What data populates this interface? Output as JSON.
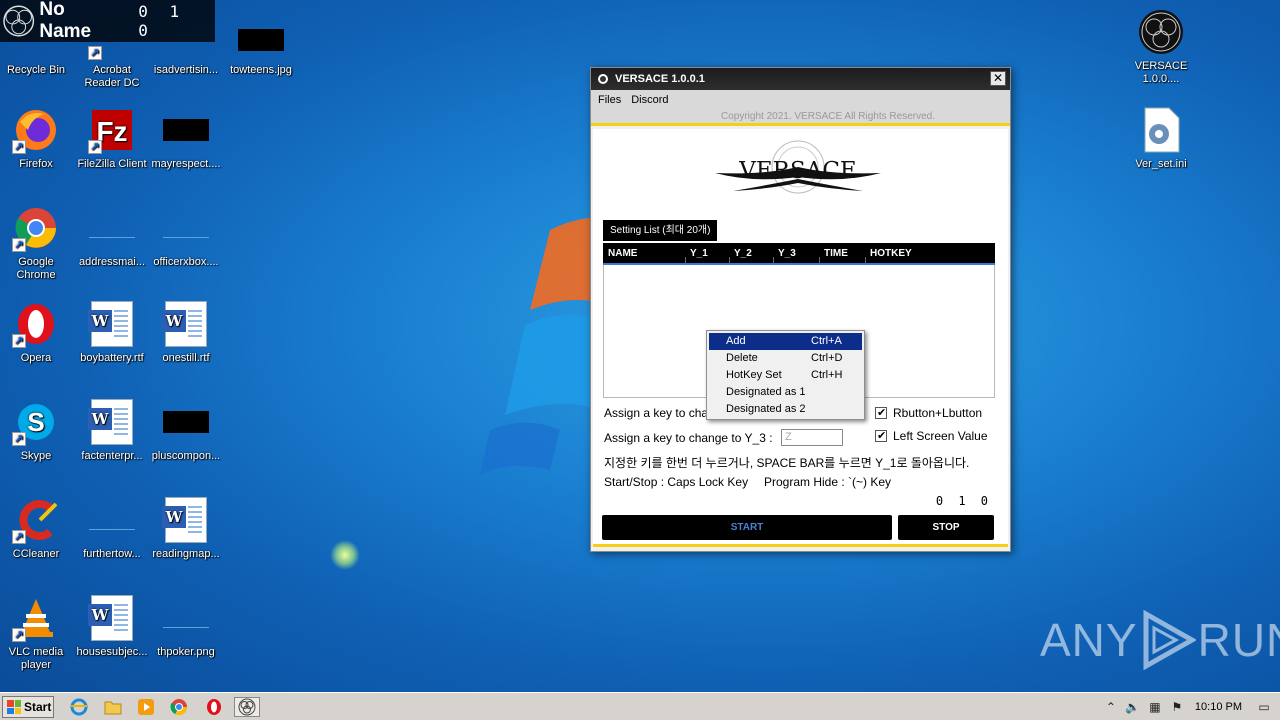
{
  "overlay": {
    "title": "No Name",
    "counter": "0 1 0"
  },
  "desktop_icons": {
    "recycle_bin": "Recycle Bin",
    "acrobat": "Acrobat Reader DC",
    "isadvertising": "isadvertisin...",
    "towteens": "towteens.jpg",
    "firefox": "Firefox",
    "filezilla": "FileZilla Client",
    "mayrespect": "mayrespect....",
    "chrome": "Google Chrome",
    "addressmai": "addressmai...",
    "officerxbox": "officerxbox....",
    "opera": "Opera",
    "boybattery": "boybattery.rtf",
    "onestill": "onestill.rtf",
    "skype": "Skype",
    "factenterpr": "factenterpr...",
    "pluscompon": "pluscompon...",
    "ccleaner": "CCleaner",
    "furthertow": "furthertow...",
    "readingmap": "readingmap...",
    "vlc": "VLC media player",
    "housesubjec": "housesubjec...",
    "thpoker": "thpoker.png",
    "versace_app": "VERSACE 1.0.0....",
    "ver_set": "Ver_set.ini"
  },
  "window": {
    "title": "VERSACE 1.0.0.1",
    "menu": [
      "Files",
      "Discord"
    ],
    "copyright": "Copyright 2021. VERSACE All Rights Reserved.",
    "brand": "VERSACE",
    "tab_label": "Setting List (최대 20개)",
    "columns": [
      "NAME",
      "Y_1",
      "Y_2",
      "Y_3",
      "TIME",
      "HOTKEY"
    ],
    "assign_y2_label": "Assign a key to change to Y_2 :",
    "assign_y3_label": "Assign a key to change to Y_3 :",
    "assign_y3_value": "Z",
    "checkbox_1": "Rbutton+Lbutton",
    "checkbox_2": "Left Screen Value",
    "korean_hint": "지정한 키를 한번 더 누르거나, SPACE BAR를 누르면 Y_1로 돌아옵니다.",
    "start_stop_hint": "Start/Stop : Caps Lock Key",
    "program_hide_hint": "Program Hide : `(~) Key",
    "counter": "0 1 0",
    "start_label": "START",
    "stop_label": "STOP"
  },
  "context_menu": [
    {
      "label": "Add",
      "shortcut": "Ctrl+A"
    },
    {
      "label": "Delete",
      "shortcut": "Ctrl+D"
    },
    {
      "label": "HotKey Set",
      "shortcut": "Ctrl+H"
    },
    {
      "label": "Designated as 1",
      "shortcut": ""
    },
    {
      "label": "Designated as 2",
      "shortcut": ""
    }
  ],
  "taskbar": {
    "start_label": "Start",
    "clock": "10:10 PM"
  },
  "watermark": {
    "left": "ANY",
    "right": "RUN"
  },
  "colors": {
    "accent_yellow": "#f5cf16",
    "menu_highlight": "#0c2d8a",
    "start_text": "#4c80d4"
  }
}
